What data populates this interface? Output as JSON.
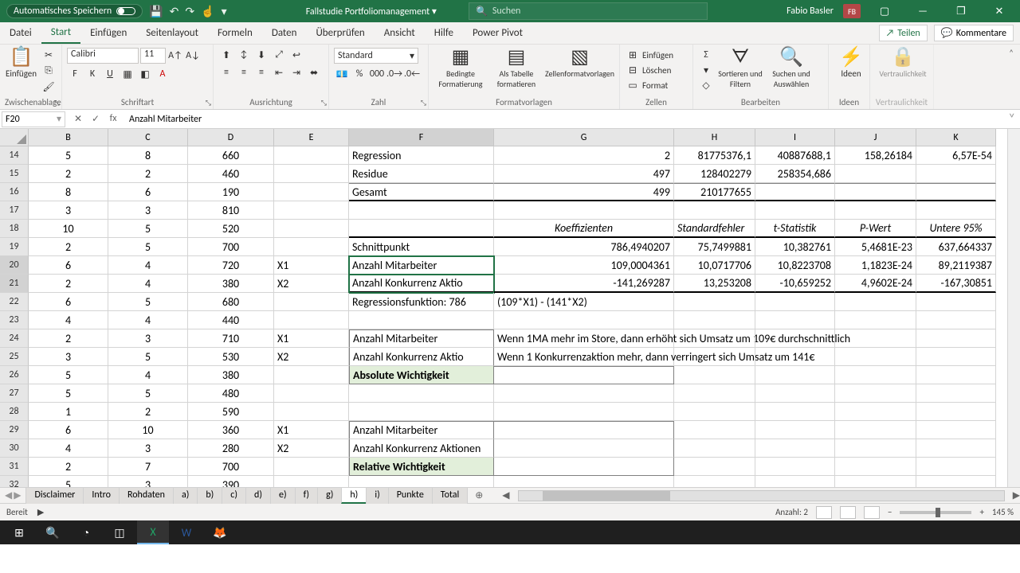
{
  "title_bar": {
    "auto_save": "Automatisches Speichern",
    "doc_title": "Fallstudie Portfoliomanagement ▾",
    "search_placeholder": "Suchen",
    "user_name": "Fabio Basler",
    "user_initials": "FB"
  },
  "tabs": {
    "datei": "Datei",
    "start": "Start",
    "einfuegen": "Einfügen",
    "seitenlayout": "Seitenlayout",
    "formeln": "Formeln",
    "daten": "Daten",
    "ueberpruefen": "Überprüfen",
    "ansicht": "Ansicht",
    "hilfe": "Hilfe",
    "powerpivot": "Power Pivot",
    "teilen": "Teilen",
    "kommentare": "Kommentare"
  },
  "ribbon": {
    "clipboard": "Zwischenablage",
    "paste": "Einfügen",
    "font": "Schriftart",
    "font_name": "Calibri",
    "font_size": "11",
    "alignment": "Ausrichtung",
    "number": "Zahl",
    "number_format": "Standard",
    "styles": "Formatvorlagen",
    "cond_fmt": "Bedingte Formatierung",
    "as_table": "Als Tabelle formatieren",
    "cell_styles": "Zellenformatvorlagen",
    "cells": "Zellen",
    "insert": "Einfügen",
    "delete": "Löschen",
    "format": "Format",
    "editing": "Bearbeiten",
    "sort_filter": "Sortieren und Filtern",
    "find_select": "Suchen und Auswählen",
    "ideas": "Ideen",
    "ideas_btn": "Ideen",
    "sensitivity": "Vertraulichkeit",
    "sensitivity_btn": "Vertraulichkeit"
  },
  "formula_bar": {
    "name_box": "F20",
    "fx": "fx",
    "formula": "Anzahl Mitarbeiter"
  },
  "columns": [
    "B",
    "C",
    "D",
    "E",
    "F",
    "G",
    "H",
    "I",
    "J",
    "K"
  ],
  "row_headers": [
    14,
    15,
    16,
    17,
    18,
    19,
    20,
    21,
    22,
    23,
    24,
    25,
    26,
    27,
    28,
    29,
    30,
    31,
    32
  ],
  "data_left": [
    {
      "b": "5",
      "c": "8",
      "d": "660"
    },
    {
      "b": "2",
      "c": "2",
      "d": "460"
    },
    {
      "b": "8",
      "c": "6",
      "d": "190"
    },
    {
      "b": "3",
      "c": "3",
      "d": "810"
    },
    {
      "b": "10",
      "c": "5",
      "d": "520"
    },
    {
      "b": "2",
      "c": "5",
      "d": "700"
    },
    {
      "b": "6",
      "c": "4",
      "d": "720",
      "e": "X1"
    },
    {
      "b": "2",
      "c": "4",
      "d": "380",
      "e": "X2"
    },
    {
      "b": "6",
      "c": "5",
      "d": "680"
    },
    {
      "b": "4",
      "c": "4",
      "d": "440"
    },
    {
      "b": "2",
      "c": "3",
      "d": "710",
      "e": "X1"
    },
    {
      "b": "3",
      "c": "5",
      "d": "530",
      "e": "X2"
    },
    {
      "b": "5",
      "c": "4",
      "d": "380"
    },
    {
      "b": "5",
      "c": "5",
      "d": "480"
    },
    {
      "b": "1",
      "c": "2",
      "d": "590"
    },
    {
      "b": "6",
      "c": "10",
      "d": "360",
      "e": "X1"
    },
    {
      "b": "4",
      "c": "3",
      "d": "280",
      "e": "X2"
    },
    {
      "b": "2",
      "c": "7",
      "d": "700"
    },
    {
      "b": "5",
      "c": "3",
      "d": "390"
    }
  ],
  "anova": {
    "rows": [
      {
        "f": "Regression",
        "g": "2",
        "h": "81775376,1",
        "i": "40887688,1",
        "j": "158,26184",
        "k": "6,57E-54"
      },
      {
        "f": "Residue",
        "g": "497",
        "h": "128402279",
        "i": "258354,686",
        "j": "",
        "k": ""
      },
      {
        "f": "Gesamt",
        "g": "499",
        "h": "210177655",
        "i": "",
        "j": "",
        "k": ""
      }
    ],
    "coef_hdr": {
      "g": "Koeffizienten",
      "h": "Standardfehler",
      "i": "t-Statistik",
      "j": "P-Wert",
      "k": "Untere 95%"
    },
    "coef": [
      {
        "f": "Schnittpunkt",
        "g": "786,4940207",
        "h": "75,7499881",
        "i": "10,382761",
        "j": "5,4681E-23",
        "k": "637,664337"
      },
      {
        "f": "Anzahl Mitarbeiter",
        "g": "109,0004361",
        "h": "10,0717706",
        "i": "10,8223708",
        "j": "1,1823E-24",
        "k": "89,2119387"
      },
      {
        "f": "Anzahl Konkurrenz Aktio",
        "g": "-141,269287",
        "h": "13,253208",
        "i": "-10,659252",
        "j": "4,9602E-24",
        "k": "-167,30851"
      }
    ],
    "reg_func_f": "Regressionsfunktion: 786",
    "reg_func_g": "(109*X1) - (141*X2)"
  },
  "interp": {
    "r1": {
      "f": "Anzahl Mitarbeiter",
      "g": "Wenn 1MA mehr im Store, dann erhöht sich Umsatz um 109€ durchschnittlich"
    },
    "r2": {
      "f": "Anzahl Konkurrenz Aktio",
      "g": "Wenn 1 Konkurrenzaktion mehr, dann verringert sich Umsatz um 141€"
    },
    "abs": "Absolute Wichtigkeit",
    "r3": {
      "f": "Anzahl Mitarbeiter"
    },
    "r4": {
      "f": "Anzahl Konkurrenz Aktionen"
    },
    "rel": "Relative Wichtigkeit"
  },
  "sheet_tabs": [
    "Disclaimer",
    "Intro",
    "Rohdaten",
    "a)",
    "b)",
    "c)",
    "d)",
    "e)",
    "f)",
    "g)",
    "h)",
    "i)",
    "Punkte",
    "Total"
  ],
  "active_sheet": "h)",
  "status": {
    "ready": "Bereit",
    "count": "Anzahl: 2",
    "zoom": "145 %"
  }
}
